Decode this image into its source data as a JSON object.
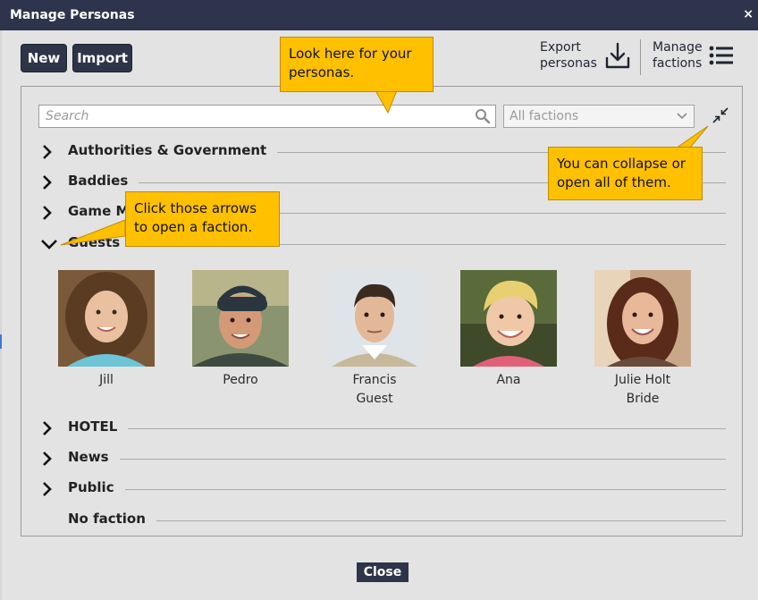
{
  "window": {
    "title": "Manage Personas",
    "close_glyph": "×"
  },
  "toolbar": {
    "new_label": "New",
    "import_label": "Import",
    "export_label": "Export\npersonas",
    "export_icon": "download-icon",
    "manage_label": "Manage\nfactions",
    "manage_icon": "list-icon"
  },
  "search": {
    "placeholder": "Search",
    "icon": "search-icon"
  },
  "faction_filter": {
    "value": "All factions"
  },
  "factions": [
    {
      "name": "Authorities & Government",
      "state": "collapsed"
    },
    {
      "name": "Baddies",
      "state": "collapsed"
    },
    {
      "name": "Game Me",
      "state": "collapsed"
    },
    {
      "name": "Guests",
      "state": "expanded"
    },
    {
      "name": "HOTEL",
      "state": "collapsed"
    },
    {
      "name": "News",
      "state": "collapsed"
    },
    {
      "name": "Public",
      "state": "collapsed"
    },
    {
      "name": "No faction",
      "state": "none"
    }
  ],
  "personas": [
    {
      "name": "Jill",
      "subtitle": ""
    },
    {
      "name": "Pedro",
      "subtitle": ""
    },
    {
      "name": "Francis",
      "subtitle": "Guest"
    },
    {
      "name": "Ana",
      "subtitle": ""
    },
    {
      "name": "Julie Holt",
      "subtitle": "Bride"
    }
  ],
  "callouts": {
    "personas": "Look here for your personas.",
    "collapse": "You can collapse or open all of them.",
    "arrows": "Click those arrows to open a faction."
  },
  "footer": {
    "close_label": "Close"
  },
  "colors": {
    "titlebar": "#2d344b",
    "button": "#2e3549",
    "callout": "#ffc000",
    "background": "#e3e3e3"
  }
}
